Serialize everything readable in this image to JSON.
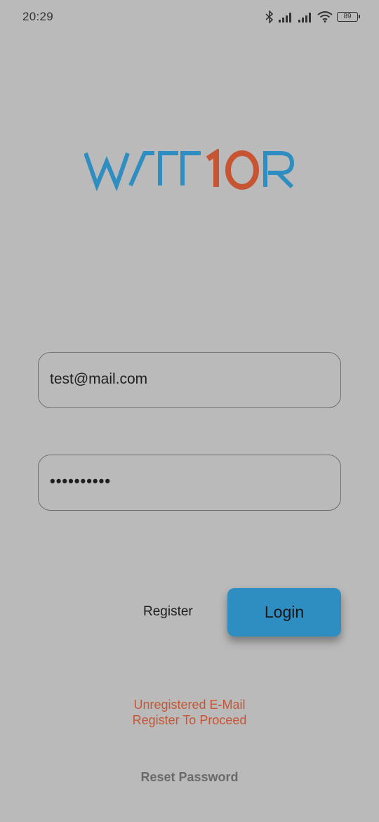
{
  "status_bar": {
    "time": "20:29",
    "battery": "89",
    "icons": [
      "bluetooth-icon",
      "signal-icon",
      "signal-icon",
      "wifi-icon",
      "battery-icon"
    ]
  },
  "logo": {
    "text": "WARRIOR",
    "colors": {
      "primary": "#2e8ec2",
      "accent": "#c75533"
    }
  },
  "form": {
    "email_value": "test@mail.com",
    "password_value": "••••••••••"
  },
  "actions": {
    "register_label": "Register",
    "login_label": "Login"
  },
  "message": {
    "line1": "Unregistered E-Mail",
    "line2": "Register To Proceed",
    "color": "#c75533"
  },
  "reset": {
    "label": "Reset Password"
  }
}
